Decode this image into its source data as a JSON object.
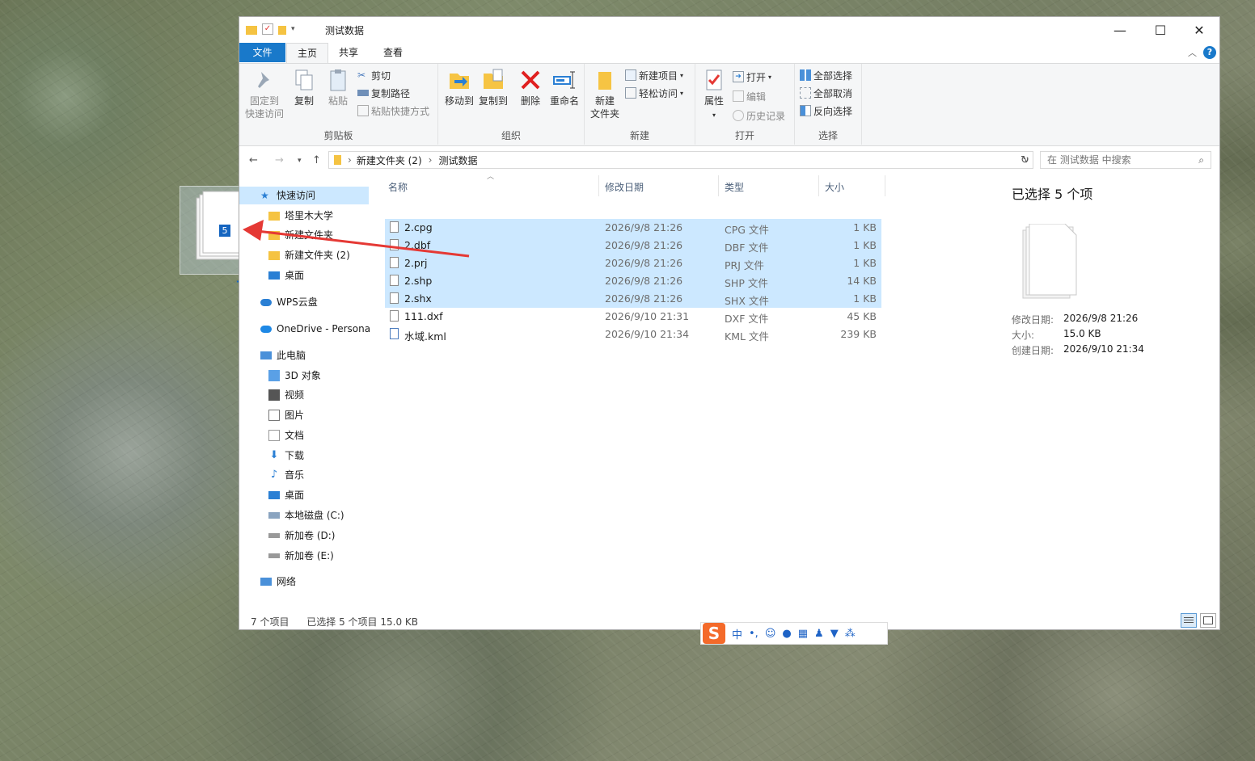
{
  "window": {
    "title": "测试数据",
    "controls": {
      "minimize": "—",
      "maximize": "☐",
      "close": "✕"
    }
  },
  "menu": {
    "file": "文件",
    "home": "主页",
    "share": "共享",
    "view": "查看",
    "help": "?"
  },
  "ribbon": {
    "clipboard": {
      "label": "剪贴板",
      "pin": "固定到",
      "pin2": "快速访问",
      "copy": "复制",
      "paste": "粘贴",
      "cut": "剪切",
      "copy_path": "复制路径",
      "paste_shortcut": "粘贴快捷方式"
    },
    "organize": {
      "label": "组织",
      "move_to": "移动到",
      "copy_to": "复制到",
      "delete": "删除",
      "rename": "重命名"
    },
    "new": {
      "label": "新建",
      "new_folder": "新建",
      "new_folder2": "文件夹",
      "new_item": "新建项目",
      "easy_access": "轻松访问"
    },
    "open": {
      "label": "打开",
      "properties": "属性",
      "open": "打开",
      "edit": "编辑",
      "history": "历史记录"
    },
    "select": {
      "label": "选择",
      "select_all": "全部选择",
      "select_none": "全部取消",
      "invert": "反向选择"
    }
  },
  "address": {
    "path": [
      "新建文件夹 (2)",
      "测试数据"
    ],
    "search_placeholder": "在 测试数据 中搜索"
  },
  "nav": {
    "items": [
      {
        "label": "快速访问"
      },
      {
        "label": "塔里木大学"
      },
      {
        "label": "新建文件夹"
      },
      {
        "label": "新建文件夹 (2)"
      },
      {
        "label": "桌面"
      },
      {
        "label": "WPS云盘"
      },
      {
        "label": "OneDrive - Persona"
      },
      {
        "label": "此电脑"
      },
      {
        "label": "3D 对象"
      },
      {
        "label": "视频"
      },
      {
        "label": "图片"
      },
      {
        "label": "文档"
      },
      {
        "label": "下载"
      },
      {
        "label": "音乐"
      },
      {
        "label": "桌面"
      },
      {
        "label": "本地磁盘 (C:)"
      },
      {
        "label": "新加卷 (D:)"
      },
      {
        "label": "新加卷 (E:)"
      },
      {
        "label": "网络"
      }
    ]
  },
  "columns": {
    "name": "名称",
    "date": "修改日期",
    "type": "类型",
    "size": "大小"
  },
  "files": [
    {
      "name": "2.cpg",
      "date": "2026/9/8 21:26",
      "type": "CPG 文件",
      "size": "1 KB",
      "selected": true
    },
    {
      "name": "2.dbf",
      "date": "2026/9/8 21:26",
      "type": "DBF 文件",
      "size": "1 KB",
      "selected": true
    },
    {
      "name": "2.prj",
      "date": "2026/9/8 21:26",
      "type": "PRJ 文件",
      "size": "1 KB",
      "selected": true
    },
    {
      "name": "2.shp",
      "date": "2026/9/8 21:26",
      "type": "SHP 文件",
      "size": "14 KB",
      "selected": true
    },
    {
      "name": "2.shx",
      "date": "2026/9/8 21:26",
      "type": "SHX 文件",
      "size": "1 KB",
      "selected": true
    },
    {
      "name": "111.dxf",
      "date": "2026/9/10 21:31",
      "type": "DXF 文件",
      "size": "45 KB",
      "selected": false
    },
    {
      "name": "水域.kml",
      "date": "2026/9/10 21:34",
      "type": "KML 文件",
      "size": "239 KB",
      "selected": false
    }
  ],
  "details": {
    "heading": "已选择 5 个项",
    "modified_label": "修改日期:",
    "modified_value": "2026/9/8 21:26",
    "size_label": "大小:",
    "size_value": "15.0 KB",
    "created_label": "创建日期:",
    "created_value": "2026/9/10 21:34"
  },
  "status": {
    "count": "7 个项目",
    "selected": "已选择 5 个项目 15.0 KB"
  },
  "drag": {
    "badge": "5",
    "plus": "+"
  },
  "ime": {
    "logo": "S",
    "mode": "中",
    "punct": "•,"
  }
}
